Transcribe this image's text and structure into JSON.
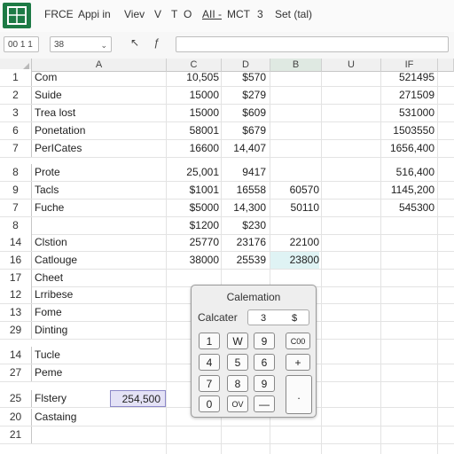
{
  "ribbon": {
    "menu": [
      "FRCE",
      "Appi in",
      "Viev",
      "V",
      "T",
      "O",
      "AII -",
      "MCT",
      "3",
      "Set (tal)"
    ]
  },
  "formula_bar": {
    "name_box": "00 1 1",
    "font_box": "38",
    "cancel_icon": "↖",
    "fx_label": "ƒ",
    "formula": ""
  },
  "columns": [
    "A",
    "C",
    "D",
    "B",
    "U",
    "IF"
  ],
  "rows": [
    {
      "num": "1",
      "a": "Com",
      "c": "10,505",
      "d": "$570",
      "b": "",
      "f": "521495"
    },
    {
      "num": "2",
      "a": "Suide",
      "c": "15000",
      "d": "$279",
      "b": "",
      "f": "271509"
    },
    {
      "num": "3",
      "a": "Trea lost",
      "c": "15000",
      "d": "$609",
      "b": "",
      "f": "531000"
    },
    {
      "num": "6",
      "a": "Ponetation",
      "c": "58001",
      "d": "$679",
      "b": "",
      "f": "1503550"
    },
    {
      "num": "7",
      "a": "PerICates",
      "c": "16600",
      "d": "14,407",
      "b": "",
      "f": "1656,400"
    },
    {
      "num": "8",
      "a": "Prote",
      "c": "25,001",
      "d": "9417",
      "b": "",
      "f": "516,400"
    },
    {
      "num": "9",
      "a": "Tacls",
      "c": "$1001",
      "d": "16558",
      "b": "60570",
      "f": "1145,200"
    },
    {
      "num": "7",
      "a": "Fuche",
      "c": "$5000",
      "d": "14,300",
      "b": "50110",
      "f": "545300"
    },
    {
      "num": "8",
      "a": "",
      "c": "$1200",
      "d": "$230",
      "b": "",
      "f": ""
    },
    {
      "num": "14",
      "a": "Clstion",
      "c": "25770",
      "d": "23176",
      "b": "22100",
      "f": ""
    },
    {
      "num": "16",
      "a": "Catlouge",
      "c": "38000",
      "d": "25539",
      "b": "23800",
      "f": ""
    },
    {
      "num": "17",
      "a": "Cheet",
      "c": "",
      "d": "",
      "b": "",
      "f": ""
    },
    {
      "num": "12",
      "a": "Lrribese",
      "c": "",
      "d": "",
      "b": "",
      "f": ""
    },
    {
      "num": "13",
      "a": "Fome",
      "c": "",
      "d": "",
      "b": "",
      "f": ""
    },
    {
      "num": "29",
      "a": "Dinting",
      "c": "",
      "d": "",
      "b": "",
      "f": ""
    },
    {
      "num": "14",
      "a": "Tucle",
      "c": "",
      "d": "",
      "b": "",
      "f": ""
    },
    {
      "num": "27",
      "a": "Peme",
      "c": "",
      "d": "",
      "b": "",
      "f": ""
    },
    {
      "num": "25",
      "a": "Flstery",
      "c": "",
      "d": "",
      "b": "",
      "f": ""
    },
    {
      "num": "20",
      "a": "Castaing",
      "c": "",
      "d": "",
      "b": "",
      "f": ""
    },
    {
      "num": "21",
      "a": "",
      "c": "",
      "d": "",
      "b": "",
      "f": ""
    }
  ],
  "selected_cell_value": "254,500",
  "calculator": {
    "title": "Calemation",
    "label": "Calcater",
    "display_left": "3",
    "display_right": "$",
    "keys": [
      "1",
      "W",
      "9",
      "C00",
      "4",
      "5",
      "6",
      "+",
      "7",
      "8",
      "9",
      "0",
      "OV",
      "—",
      "."
    ]
  },
  "colors": {
    "brand": "#1d7a45",
    "selected_header": "#dfe9e2",
    "cyan_highlight": "#dff3f4",
    "blue_highlight": "#e4e2f6"
  }
}
